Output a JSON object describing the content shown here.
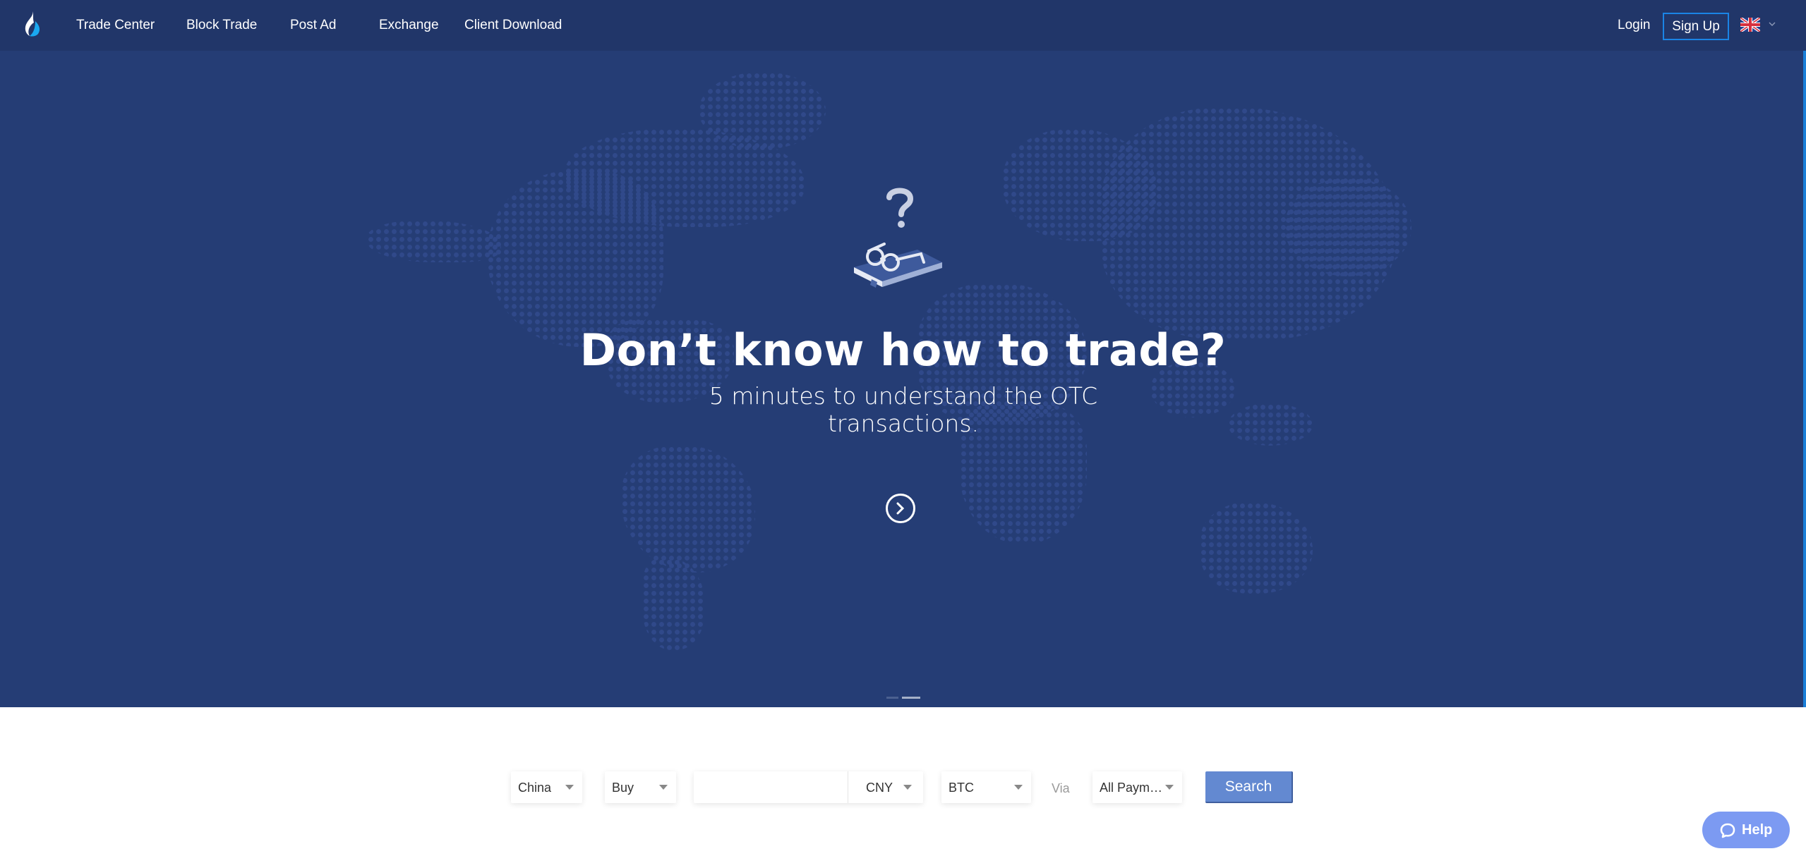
{
  "nav": {
    "logo": "huobi-flame-logo",
    "items": [
      {
        "label": "Trade Center"
      },
      {
        "label": "Block Trade"
      },
      {
        "label": "Post Ad"
      },
      {
        "label": "Exchange"
      },
      {
        "label": "Client Download"
      }
    ],
    "login_label": "Login",
    "signup_label": "Sign Up",
    "language_icon": "uk-flag-icon"
  },
  "hero": {
    "title": "Don’t know how to trade?",
    "subtitle": "5 minutes to understand the OTC transactions.",
    "illustration": "question-book-glasses-icon",
    "next_icon": "chevron-right-circle-icon",
    "slides_total": 2,
    "active_slide": 2
  },
  "search": {
    "country": "China",
    "side": "Buy",
    "amount_value": "",
    "amount_placeholder": "",
    "fiat_currency": "CNY",
    "crypto": "BTC",
    "via_label": "Via",
    "payment": "All Paym…",
    "search_label": "Search"
  },
  "help": {
    "label": "Help",
    "icon": "chat-bubble-icon"
  },
  "colors": {
    "nav_bg": "#213669",
    "hero_bg": "#253d75",
    "signup_border": "#1a84e5",
    "search_button": "#6389d1",
    "help_button": "#7c9af2",
    "logo_blue": "#1aa8f0"
  }
}
